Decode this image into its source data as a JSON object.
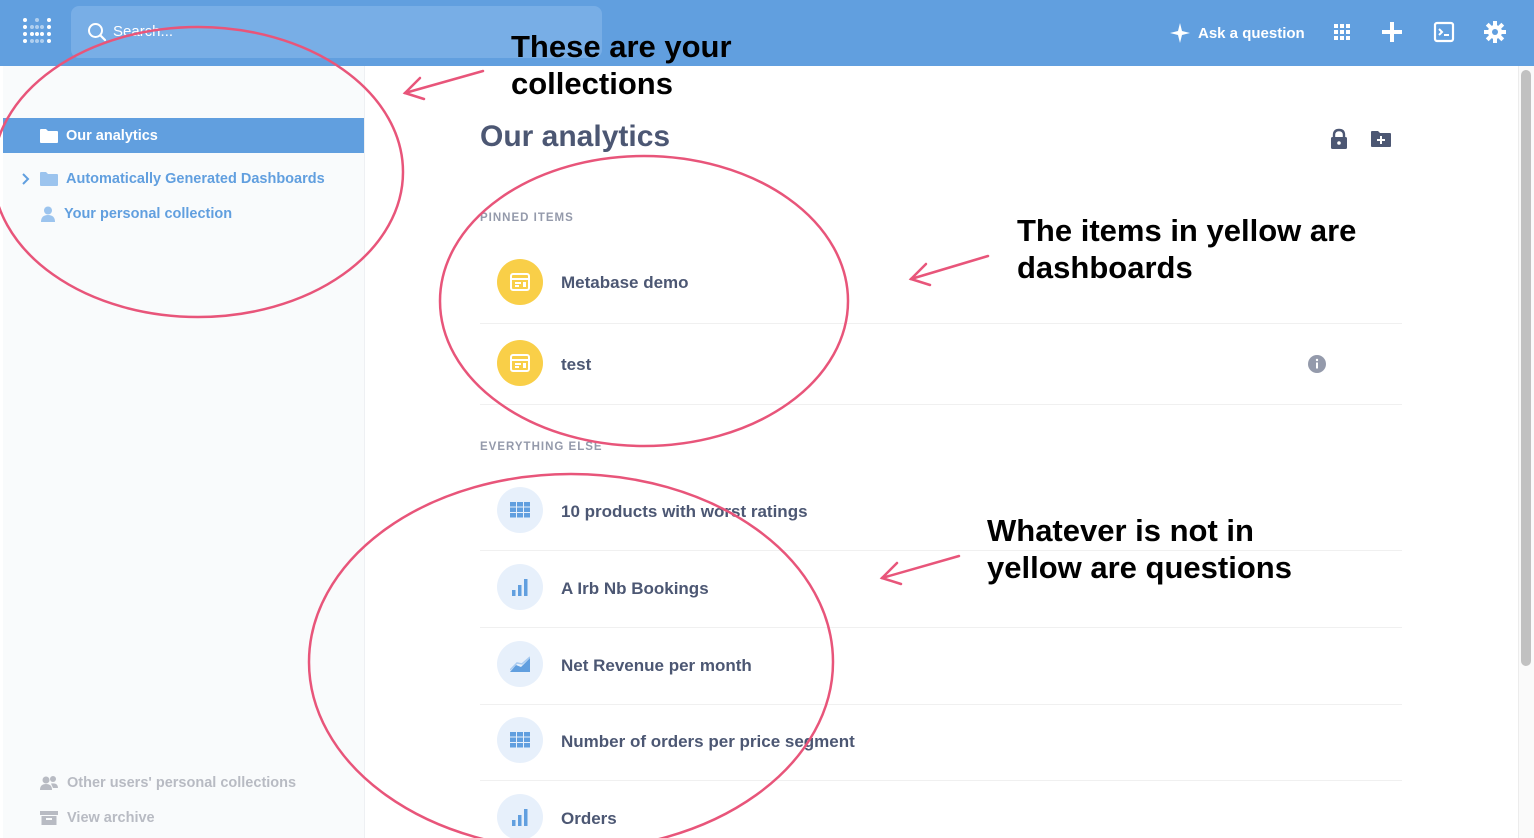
{
  "topbar": {
    "search_placeholder": "Search...",
    "ask_label": "Ask a question",
    "colors": {
      "bar": "#619fdf",
      "search_bg": "#78aee6"
    }
  },
  "sidebar": {
    "items": [
      {
        "label": "Our analytics",
        "icon": "folder-icon",
        "active": true
      },
      {
        "label": "Automatically Generated Dashboards",
        "icon": "folder-icon",
        "expandable": true
      },
      {
        "label": "Your personal collection",
        "icon": "person-icon"
      }
    ],
    "footer": [
      {
        "label": "Other users' personal collections",
        "icon": "group-icon"
      },
      {
        "label": "View archive",
        "icon": "archive-icon"
      }
    ]
  },
  "main": {
    "title": "Our analytics",
    "pinned_label": "PINNED ITEMS",
    "everything_label": "EVERYTHING ELSE",
    "pinned": [
      {
        "name": "Metabase demo",
        "icon": "dashboard-icon"
      },
      {
        "name": "test",
        "icon": "dashboard-icon"
      }
    ],
    "others": [
      {
        "name": "10 products with worst ratings",
        "icon": "table-icon"
      },
      {
        "name": "A Irb Nb Bookings",
        "icon": "bar-chart-icon"
      },
      {
        "name": "Net Revenue per month",
        "icon": "area-chart-icon"
      },
      {
        "name": "Number of orders per price segment",
        "icon": "table-icon"
      },
      {
        "name": "Orders",
        "icon": "bar-chart-icon"
      }
    ],
    "colors": {
      "dashboard": "#f9cf48",
      "question": "#e7f0fb",
      "accent": "#619fdf"
    }
  },
  "annotations": {
    "collections": [
      "These are your",
      "collections"
    ],
    "dashboards": [
      "The items in yellow are",
      "dashboards"
    ],
    "questions": [
      "Whatever is not in",
      "yellow are questions"
    ],
    "color": "#e8557a"
  }
}
